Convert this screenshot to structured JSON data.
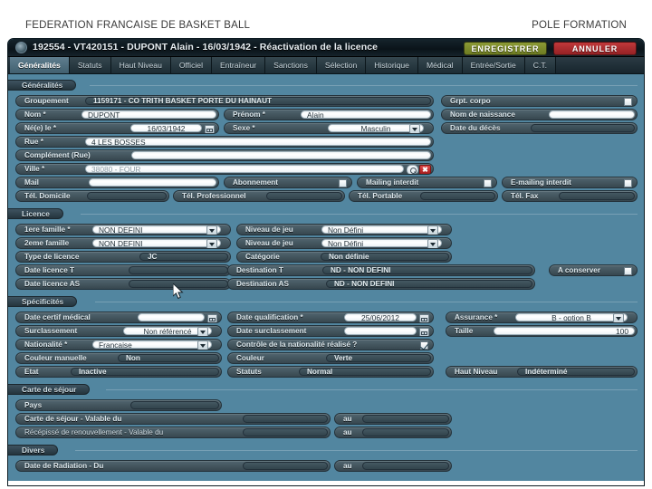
{
  "slide": {
    "header_left": "FEDERATION FRANCAISE DE BASKET BALL",
    "header_right": "POLE FORMATION"
  },
  "window": {
    "title": "192554 - VT420151 - DUPONT Alain - 16/03/1942 - Réactivation de la licence",
    "save_label": "ENREGISTRER",
    "cancel_label": "ANNULER",
    "logo_icon": "app-logo-icon",
    "colors": {
      "save": "#7d8c2c",
      "cancel": "#b02d2f",
      "form_bg": "#5286a0",
      "titlebar": "#0d1a21"
    }
  },
  "tabs": [
    {
      "label": "Généralités",
      "active": true
    },
    {
      "label": "Statuts",
      "active": false
    },
    {
      "label": "Haut Niveau",
      "active": false
    },
    {
      "label": "Officiel",
      "active": false
    },
    {
      "label": "Entraîneur",
      "active": false
    },
    {
      "label": "Sanctions",
      "active": false
    },
    {
      "label": "Sélection",
      "active": false
    },
    {
      "label": "Historique",
      "active": false
    },
    {
      "label": "Médical",
      "active": false
    },
    {
      "label": "Entrée/Sortie",
      "active": false
    },
    {
      "label": "C.T.",
      "active": false
    }
  ],
  "sections": {
    "generalites": {
      "title": "Généralités",
      "groupement_label": "Groupement",
      "groupement_value": "1159171 - CO TRITH BASKET PORTE DU HAINAUT",
      "grpt_corpo_label": "Grpt. corpo",
      "nom_label": "Nom *",
      "nom_value": "DUPONT",
      "prenom_label": "Prénom *",
      "prenom_value": "Alain",
      "nom_naissance_label": "Nom de naissance",
      "nom_naissance_value": "",
      "ne_le_label": "Né(e) le *",
      "ne_le_value": "16/03/1942",
      "sexe_label": "Sexe *",
      "sexe_value": "Masculin",
      "date_deces_label": "Date du décès",
      "date_deces_value": "",
      "rue_label": "Rue *",
      "rue_value": "4 LES BOSSES",
      "complement_label": "Complément (Rue)",
      "complement_value": "",
      "ville_label": "Ville *",
      "ville_value": "38080 - FOUR",
      "mail_label": "Mail",
      "mail_value": "",
      "abonnement_label": "Abonnement",
      "mailing_interdit_label": "Mailing interdit",
      "emailing_interdit_label": "E-mailing interdit",
      "tel_domicile_label": "Tél. Domicile",
      "tel_domicile_value": "",
      "tel_professionnel_label": "Tél. Professionnel",
      "tel_professionnel_value": "",
      "tel_portable_label": "Tél. Portable",
      "tel_portable_value": "",
      "tel_fax_label": "Tél. Fax",
      "tel_fax_value": "",
      "search_icon": "search-icon",
      "clear_icon": "clear-icon"
    },
    "licence": {
      "title": "Licence",
      "famille1_label": "1ere famille *",
      "famille1_value": "NON DEFINI",
      "niveau_jeu1_label": "Niveau de jeu",
      "niveau_jeu1_value": "Non Défini",
      "famille2_label": "2eme famille",
      "famille2_value": "NON DEFINI",
      "niveau_jeu2_label": "Niveau de jeu",
      "niveau_jeu2_value": "Non Défini",
      "type_licence_label": "Type de licence",
      "type_licence_value": "JC",
      "categorie_label": "Catégorie",
      "categorie_value": "Non définie",
      "date_licence_t_label": "Date licence T",
      "date_licence_t_value": "",
      "destination_t_label": "Destination T",
      "destination_t_value": "ND - NON DEFINI",
      "a_conserver_label": "A conserver",
      "date_licence_as_label": "Date licence AS",
      "date_licence_as_value": "",
      "destination_as_label": "Destination AS",
      "destination_as_value": "ND - NON DÉFINI"
    },
    "specificites": {
      "title": "Spécificités",
      "date_certif_label": "Date certif médical",
      "date_certif_value": "",
      "date_qualif_label": "Date qualification *",
      "date_qualif_value": "25/06/2012",
      "assurance_label": "Assurance *",
      "assurance_value": "B - option B",
      "surclassement_label": "Surclassement",
      "surclassement_value": "Non référencé",
      "date_surclassement_label": "Date surclassement",
      "date_surclassement_value": "",
      "taille_label": "Taille",
      "taille_value": "100",
      "nationalite_label": "Nationalité *",
      "nationalite_value": "Française",
      "controle_nationalite_label": "Contrôle de la nationalité réalisé ?",
      "couleur_manuelle_label": "Couleur manuelle",
      "couleur_manuelle_value": "Non",
      "couleur_label": "Couleur",
      "couleur_value": "Verte",
      "etat_label": "Etat",
      "etat_value": "Inactive",
      "statuts_label": "Statuts",
      "statuts_value": "Normal",
      "haut_niveau_label": "Haut Niveau",
      "haut_niveau_value": "Indéterminé"
    },
    "carte_sejour": {
      "title": "Carte de séjour",
      "pays_label": "Pays",
      "pays_value": "",
      "carte_label": "Carte de séjour - Valable du",
      "carte_du_value": "",
      "carte_au_label": "au",
      "carte_au_value": "",
      "recepisse_label": "Récépissé de renouvellement - Valable du",
      "recepisse_du_value": "",
      "recepisse_au_label": "au",
      "recepisse_au_value": ""
    },
    "divers": {
      "title": "Divers",
      "radiation_label": "Date de Radiation - Du",
      "radiation_du_value": "",
      "radiation_au_label": "au",
      "radiation_au_value": ""
    }
  },
  "cursor": {
    "icon": "mouse-pointer-icon"
  }
}
